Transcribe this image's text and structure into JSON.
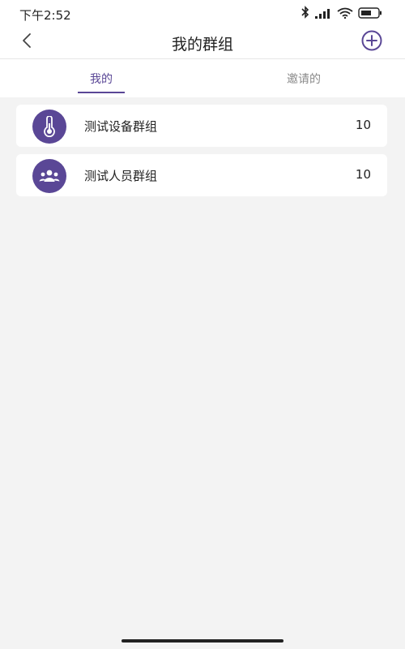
{
  "status_bar": {
    "time": "下午2:52",
    "icons": [
      "bluetooth-icon",
      "signal-icon",
      "wifi-icon",
      "battery-icon"
    ]
  },
  "nav": {
    "title": "我的群组",
    "back_icon": "chevron-left-icon",
    "add_icon": "plus-circle-icon"
  },
  "tabs": [
    {
      "label": "我的",
      "active": true
    },
    {
      "label": "邀请的",
      "active": false
    }
  ],
  "groups": [
    {
      "name": "测试设备群组",
      "count": "10",
      "icon": "thermometer-icon"
    },
    {
      "name": "测试人员群组",
      "count": "10",
      "icon": "people-icon"
    }
  ],
  "colors": {
    "accent": "#5a4796",
    "background": "#f3f3f3",
    "card": "#ffffff"
  }
}
